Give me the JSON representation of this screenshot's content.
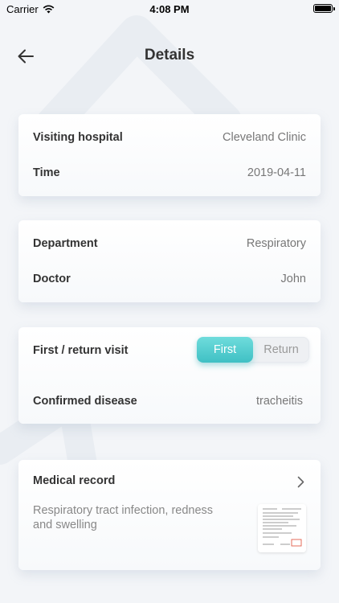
{
  "status_bar": {
    "carrier": "Carrier",
    "time": "4:08 PM"
  },
  "nav": {
    "title": "Details"
  },
  "visit": {
    "hospital_label": "Visiting hospital",
    "hospital_value": "Cleveland Clinic",
    "time_label": "Time",
    "time_value": "2019-04-11"
  },
  "department": {
    "department_label": "Department",
    "department_value": "Respiratory",
    "doctor_label": "Doctor",
    "doctor_value": "John"
  },
  "diagnosis": {
    "visit_type_label": "First / return visit",
    "visit_type_options": [
      "First",
      "Return"
    ],
    "visit_type_selected": "First",
    "disease_label": "Confirmed disease",
    "disease_value": "tracheitis"
  },
  "record": {
    "label": "Medical record",
    "description": "Respiratory tract infection, redness and swelling"
  },
  "colors": {
    "accent": "#3fc0c4",
    "background": "#f3f5f8"
  }
}
